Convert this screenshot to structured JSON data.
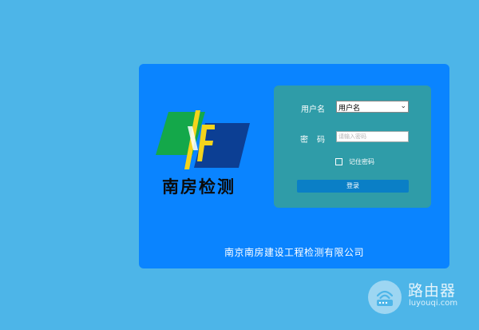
{
  "colors": {
    "background": "#4db5e8",
    "panel": "#0a84ff",
    "form_card": "#2f9ca8",
    "button": "#0a7fc6"
  },
  "logo": {
    "icon": "nanfang-logo-icon",
    "text": "南房检测"
  },
  "login_form": {
    "username_label": "用户名",
    "username_value": "用户名",
    "username_icon": "chevron-down-icon",
    "password_label": "密码",
    "password_placeholder": "请输入密码",
    "remember_label": "记住密码",
    "login_button": "登录"
  },
  "footer": {
    "company_name": "南京南房建设工程检测有限公司"
  },
  "watermark": {
    "icon": "router-icon",
    "title": "路由器",
    "url": "luyouqi.com"
  }
}
